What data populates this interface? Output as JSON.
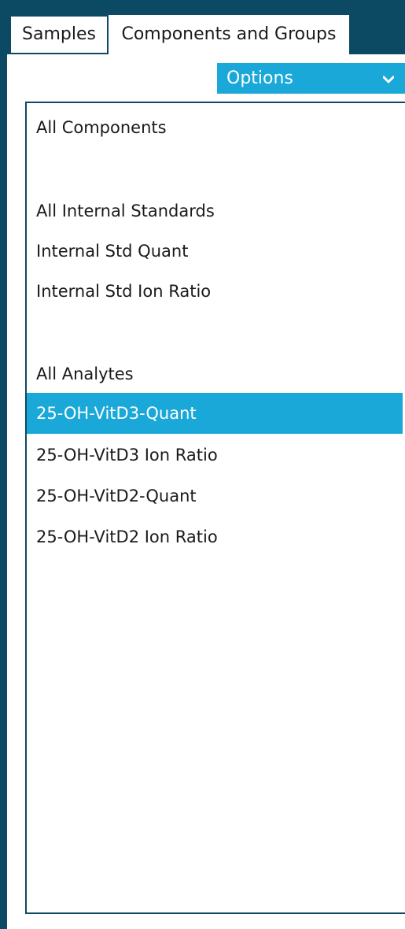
{
  "tabs": [
    {
      "label": "Samples",
      "active": false
    },
    {
      "label": "Components and Groups",
      "active": true
    }
  ],
  "options": {
    "label": "Options",
    "chevron_icon": "chevron-down-icon"
  },
  "colors": {
    "header_bg": "#0b4a62",
    "accent": "#19a8d8",
    "selected_text": "#ffffff"
  },
  "list": {
    "items": [
      {
        "label": "All Components",
        "selected": false
      },
      {
        "label": "All Internal Standards",
        "selected": false
      },
      {
        "label": "Internal Std Quant",
        "selected": false
      },
      {
        "label": "Internal Std Ion Ratio",
        "selected": false
      },
      {
        "label": "All Analytes",
        "selected": false
      },
      {
        "label": "25-OH-VitD3-Quant",
        "selected": true
      },
      {
        "label": "25-OH-VitD3 Ion Ratio",
        "selected": false
      },
      {
        "label": "25-OH-VitD2-Quant",
        "selected": false
      },
      {
        "label": "25-OH-VitD2 Ion Ratio",
        "selected": false
      }
    ]
  }
}
